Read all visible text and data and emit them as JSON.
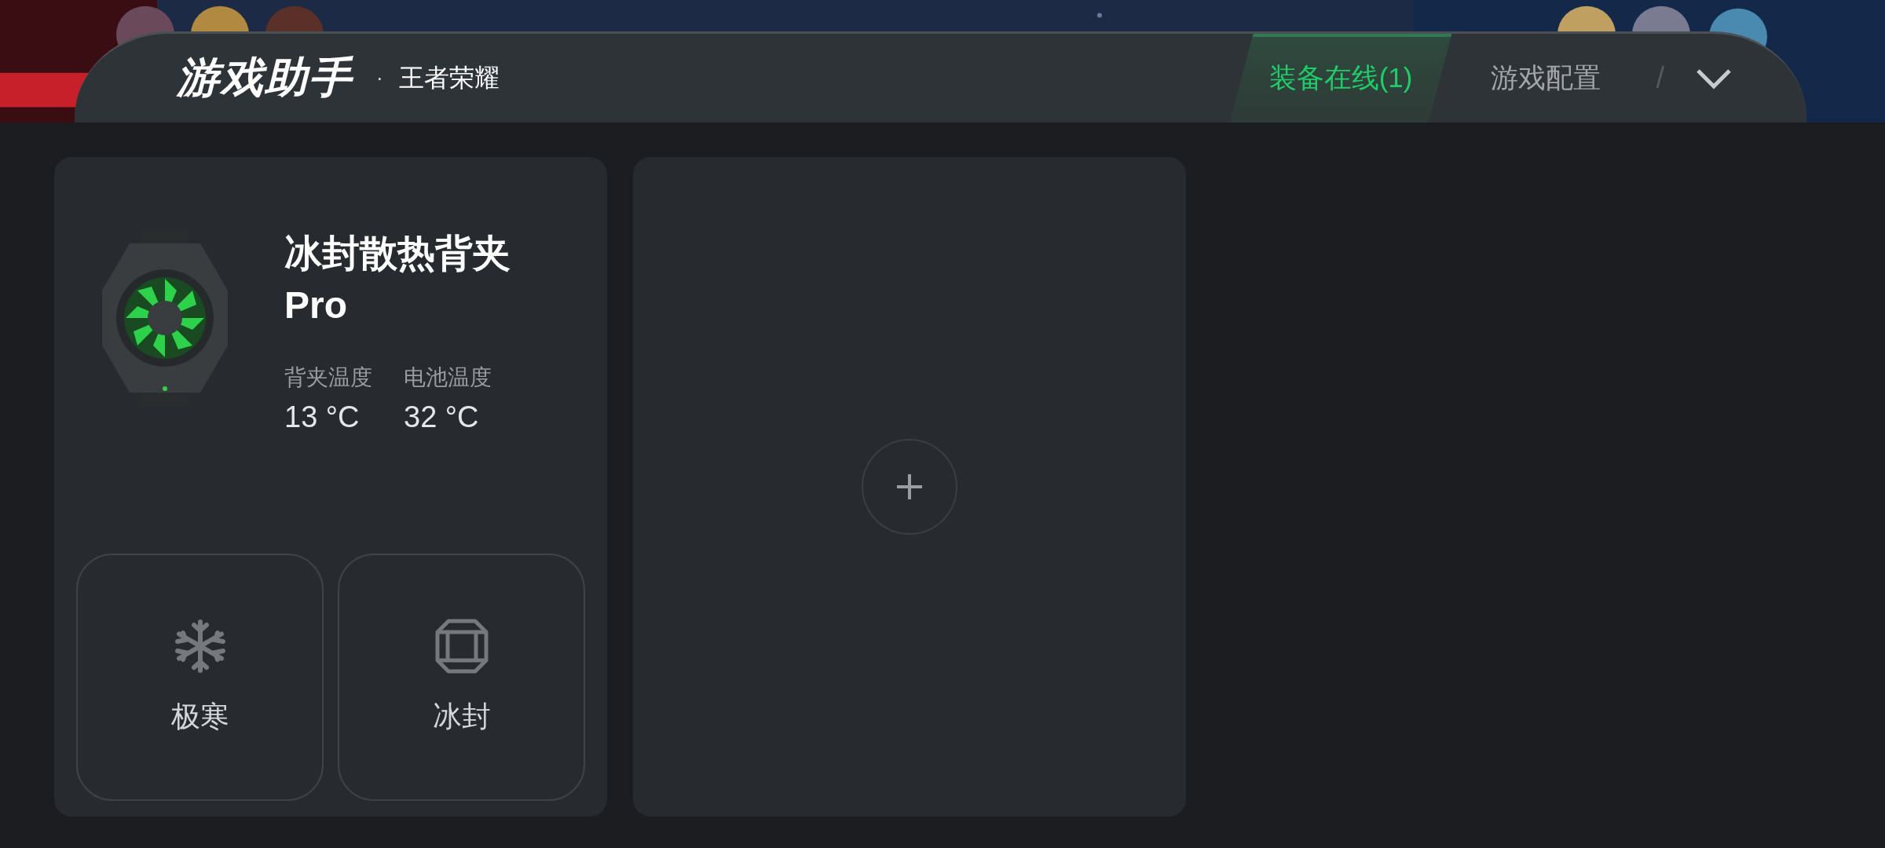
{
  "header": {
    "logo": "游戏助手",
    "separator": "·",
    "game": "王者荣耀"
  },
  "tabs": [
    {
      "label": "装备在线(1)",
      "selected": true
    },
    {
      "label": "游戏配置",
      "selected": false
    }
  ],
  "tab_divider": "/",
  "devices": [
    {
      "name": "冰封散热背夹 Pro",
      "readings": [
        {
          "label": "背夹温度",
          "value": "13 °C"
        },
        {
          "label": "电池温度",
          "value": "32 °C"
        }
      ],
      "modes": [
        {
          "label": "极寒",
          "kind": "snowflake"
        },
        {
          "label": "冰封",
          "kind": "gem"
        }
      ]
    }
  ]
}
